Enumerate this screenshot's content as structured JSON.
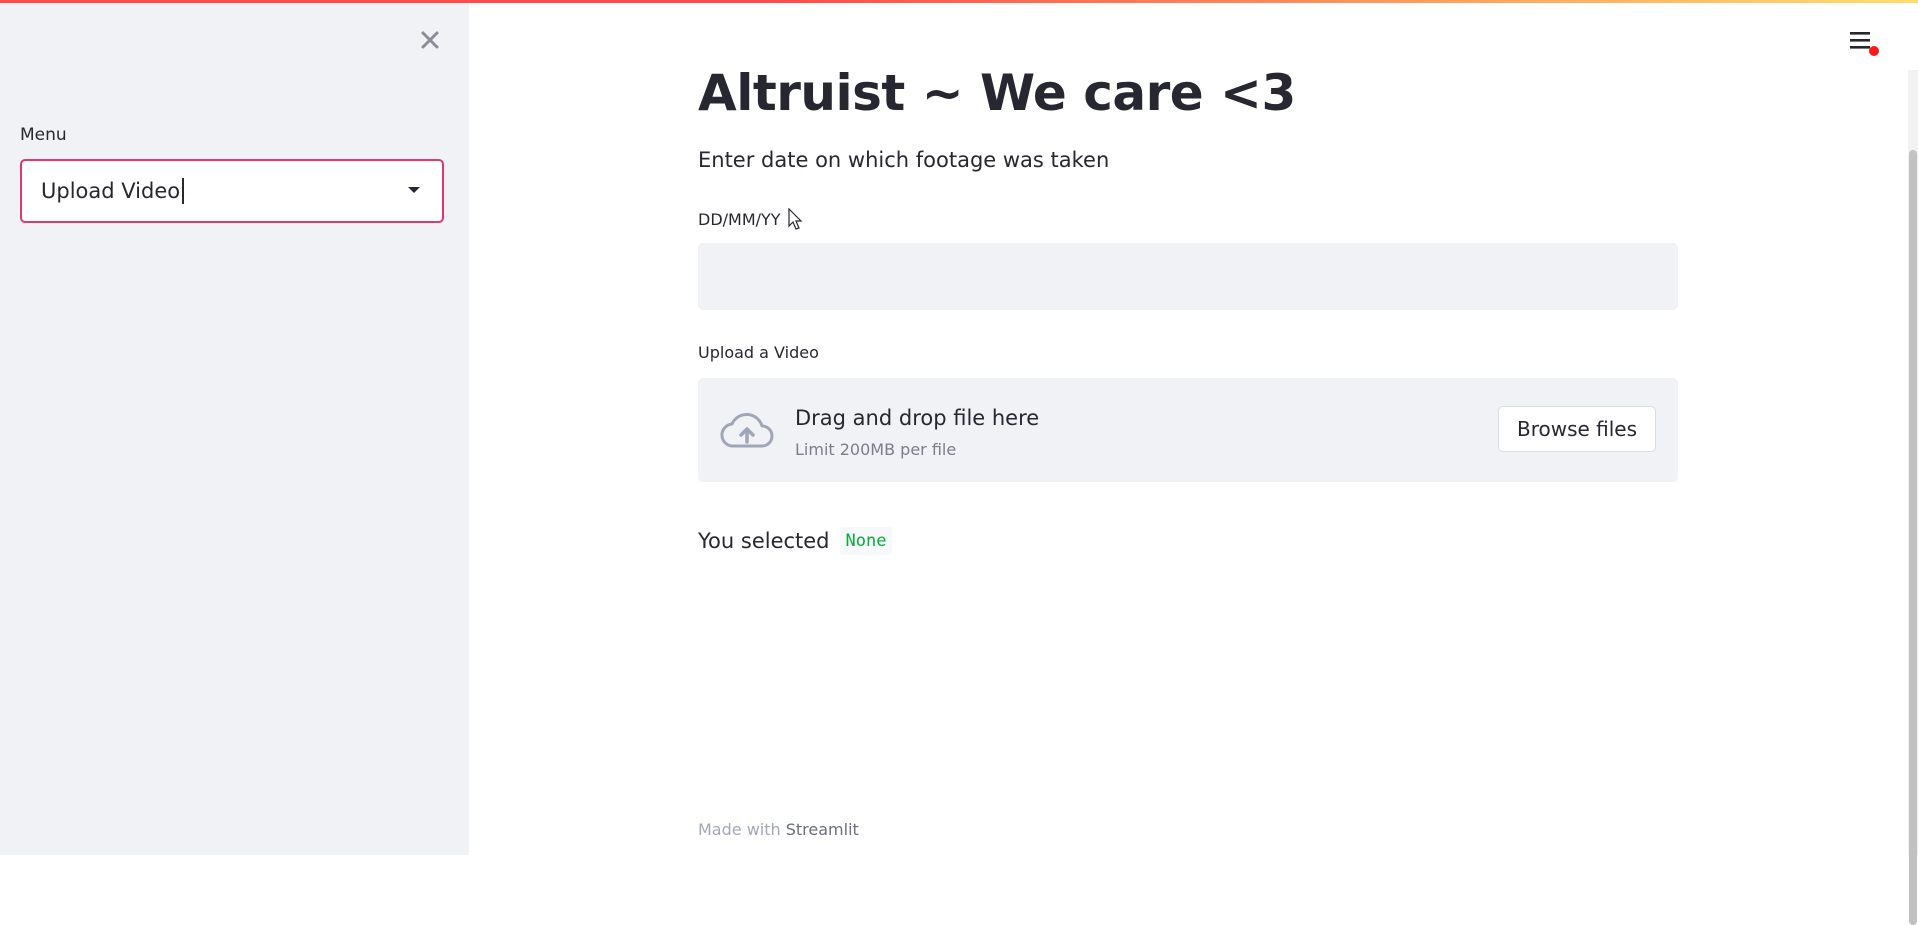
{
  "sidebar": {
    "menu_label": "Menu",
    "menu_selected": "Upload Video",
    "close_icon": "close-icon"
  },
  "header": {
    "menu_icon": "hamburger-menu-icon",
    "status_color": "#ff1a1a"
  },
  "main": {
    "title": "Altruist ~ We care <3",
    "subtitle": "Enter date on which footage was taken",
    "date_field": {
      "label": "DD/MM/YY",
      "value": ""
    },
    "uploader": {
      "label": "Upload a Video",
      "drop_title": "Drag and drop file here",
      "limit_text": "Limit 200MB per file",
      "browse_label": "Browse files",
      "icon": "cloud-upload-icon"
    },
    "selection": {
      "label": "You selected",
      "value": "None"
    }
  },
  "footer": {
    "prefix": "Made with",
    "link": "Streamlit"
  },
  "colors": {
    "accent": "#ff4b4b",
    "select_border": "#e0396f",
    "sidebar_bg": "#f0f2f6",
    "selected_value": "#09ab3b"
  }
}
